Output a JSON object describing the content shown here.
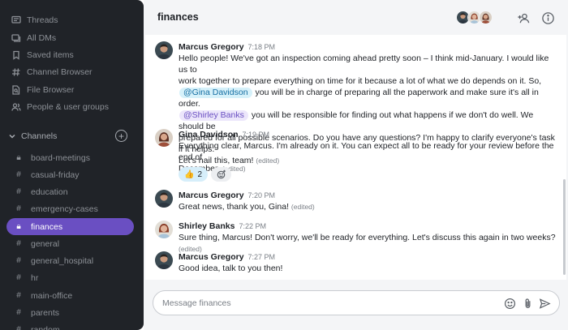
{
  "sidebar": {
    "nav": [
      {
        "label": "Threads",
        "icon": "threads-icon"
      },
      {
        "label": "All DMs",
        "icon": "dms-icon"
      },
      {
        "label": "Saved items",
        "icon": "bookmark-icon"
      },
      {
        "label": "Channel Browser",
        "icon": "channel-browser-icon"
      },
      {
        "label": "File Browser",
        "icon": "file-search-icon"
      },
      {
        "label": "People & user groups",
        "icon": "people-icon"
      }
    ],
    "channels_label": "Channels",
    "add_icon": "plus-circle-icon",
    "channels": [
      {
        "label": "board-meetings",
        "glyph": "lock"
      },
      {
        "label": "casual-friday",
        "glyph": "hash"
      },
      {
        "label": "education",
        "glyph": "hash"
      },
      {
        "label": "emergency-cases",
        "glyph": "hash"
      },
      {
        "label": "finances",
        "glyph": "lock",
        "active": true
      },
      {
        "label": "general",
        "glyph": "hash"
      },
      {
        "label": "general_hospital",
        "glyph": "hash"
      },
      {
        "label": "hr",
        "glyph": "hash"
      },
      {
        "label": "main-office",
        "glyph": "hash"
      },
      {
        "label": "parents",
        "glyph": "hash"
      },
      {
        "label": "random",
        "glyph": "hash"
      }
    ]
  },
  "header": {
    "title": "finances",
    "member_avatars": [
      "Marcus Gregory",
      "Shirley Banks",
      "Gina Davidson"
    ],
    "add_member_icon": "add-person-icon",
    "info_icon": "info-icon"
  },
  "messages": [
    {
      "name": "Marcus Gregory",
      "time": "7:18 PM",
      "line1": "Hello people! We've got an inspection coming ahead pretty soon – I think mid-January. I would like us to",
      "line2": "work together to prepare everything on time for it because a lot of what we do depends on it. So,",
      "mention1": "@Gina Davidson",
      "line3_rest": "you will be in charge of preparing all the paperwork and make sure it's all in order.",
      "mention2": "@Shirley Banks",
      "line4_rest": "you will be responsible for finding out what happens if we don't do well. We should be",
      "line5": "prepared for all possible scenarios. Do you have any questions? I'm happy to clarify everyone's task if it helps.",
      "line6": "Let's nail this, team!",
      "line6_plain": "Let's nail this, team!",
      "edited": "(edited)"
    },
    {
      "name": "Gina Davidson",
      "time": "7:19 PM",
      "line1": "Everything clear, Marcus. I'm already on it. You can expect all to be ready for your review before the end of",
      "line2": "December.",
      "edited": "(edited)",
      "reaction_emoji": "👍",
      "reaction_count": "2"
    },
    {
      "name": "Marcus Gregory",
      "time": "7:20 PM",
      "text": "Great news, thank you, Gina!",
      "edited": "(edited)"
    },
    {
      "name": "Shirley Banks",
      "time": "7:22 PM",
      "text": "Sure thing, Marcus! Don't worry, we'll be ready for everything. Let's discuss this again in two weeks?",
      "edited": "(edited)"
    },
    {
      "name": "Marcus Gregory",
      "time": "7:27 PM",
      "text": "Good idea, talk to you then!"
    }
  ],
  "composer": {
    "placeholder": "Message finances",
    "emoji_icon": "emoji-icon",
    "attach_icon": "paperclip-icon",
    "send_icon": "send-icon"
  },
  "colors": {
    "sidebar_bg": "#202328",
    "active_channel": "#6a4fc2",
    "main_bg": "#f4f5f7",
    "mention_gina_bg": "#d6f1fa",
    "mention_shirley_bg": "#ece6fb"
  }
}
